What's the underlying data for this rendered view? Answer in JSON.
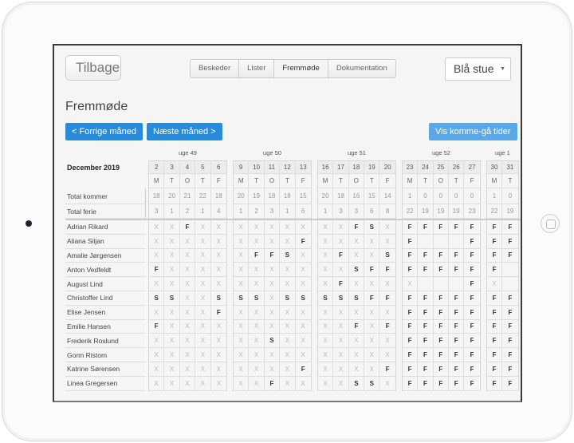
{
  "nav": {
    "back_label": "Tilbage",
    "tabs": [
      {
        "label": "Beskeder"
      },
      {
        "label": "Lister"
      },
      {
        "label": "Fremmøde",
        "active": true
      },
      {
        "label": "Dokumentation"
      }
    ],
    "room_select": "Blå stue"
  },
  "page": {
    "title": "Fremmøde",
    "prev_label": "<  Forrige måned",
    "next_label": "Næste måned  >",
    "show_times_label": "Vis komme-gå tider",
    "accent": "#2a8bd8"
  },
  "table": {
    "month": "December 2019",
    "total_kommer_label": "Total kommer",
    "total_ferie_label": "Total ferie",
    "weeks": [
      {
        "label": "uge 49",
        "days": [
          {
            "date": "2",
            "day": "M",
            "kommer": "18",
            "ferie": "3"
          },
          {
            "date": "3",
            "day": "T",
            "kommer": "20",
            "ferie": "1"
          },
          {
            "date": "4",
            "day": "O",
            "kommer": "21",
            "ferie": "2"
          },
          {
            "date": "5",
            "day": "T",
            "kommer": "22",
            "ferie": "1"
          },
          {
            "date": "6",
            "day": "F",
            "kommer": "18",
            "ferie": "4"
          }
        ]
      },
      {
        "label": "uge 50",
        "days": [
          {
            "date": "9",
            "day": "M",
            "kommer": "20",
            "ferie": "1"
          },
          {
            "date": "10",
            "day": "T",
            "kommer": "19",
            "ferie": "2"
          },
          {
            "date": "11",
            "day": "O",
            "kommer": "18",
            "ferie": "3"
          },
          {
            "date": "12",
            "day": "T",
            "kommer": "18",
            "ferie": "1"
          },
          {
            "date": "13",
            "day": "F",
            "kommer": "15",
            "ferie": "6"
          }
        ]
      },
      {
        "label": "uge 51",
        "days": [
          {
            "date": "16",
            "day": "M",
            "kommer": "20",
            "ferie": "1"
          },
          {
            "date": "17",
            "day": "T",
            "kommer": "18",
            "ferie": "3"
          },
          {
            "date": "18",
            "day": "O",
            "kommer": "16",
            "ferie": "3"
          },
          {
            "date": "19",
            "day": "T",
            "kommer": "15",
            "ferie": "6"
          },
          {
            "date": "20",
            "day": "F",
            "kommer": "14",
            "ferie": "8"
          }
        ]
      },
      {
        "label": "uge 52",
        "days": [
          {
            "date": "23",
            "day": "M",
            "kommer": "1",
            "ferie": "22"
          },
          {
            "date": "24",
            "day": "T",
            "kommer": "0",
            "ferie": "19"
          },
          {
            "date": "25",
            "day": "O",
            "kommer": "0",
            "ferie": "19"
          },
          {
            "date": "26",
            "day": "T",
            "kommer": "0",
            "ferie": "19"
          },
          {
            "date": "27",
            "day": "F",
            "kommer": "0",
            "ferie": "23"
          }
        ]
      },
      {
        "label": "uge 1",
        "days": [
          {
            "date": "30",
            "day": "M",
            "kommer": "1",
            "ferie": "22"
          },
          {
            "date": "31",
            "day": "T",
            "kommer": "0",
            "ferie": "19"
          }
        ]
      }
    ],
    "children": [
      {
        "name": "Adrian Rikard",
        "cells": [
          [
            "X",
            "X",
            "F",
            "X",
            "X"
          ],
          [
            "X",
            "X",
            "X",
            "X",
            "X"
          ],
          [
            "X",
            "X",
            "F",
            "S",
            "X"
          ],
          [
            "F",
            "F",
            "F",
            "F",
            "F"
          ],
          [
            "F",
            "F"
          ]
        ]
      },
      {
        "name": "Aliana Siljan",
        "cells": [
          [
            "X",
            "X",
            "X",
            "X",
            "X"
          ],
          [
            "X",
            "X",
            "X",
            "X",
            "F"
          ],
          [
            "X",
            "X",
            "X",
            "X",
            "X"
          ],
          [
            "F",
            "",
            "",
            "",
            "F"
          ],
          [
            "F",
            "F"
          ]
        ]
      },
      {
        "name": "Amalie Jørgensen",
        "cells": [
          [
            "X",
            "X",
            "X",
            "X",
            "X"
          ],
          [
            "X",
            "F",
            "F",
            "S",
            "X"
          ],
          [
            "X",
            "F",
            "X",
            "X",
            "S"
          ],
          [
            "F",
            "F",
            "F",
            "F",
            "F"
          ],
          [
            "F",
            "F"
          ]
        ]
      },
      {
        "name": "Anton Vedfeldt",
        "cells": [
          [
            "F",
            "X",
            "X",
            "X",
            "X"
          ],
          [
            "X",
            "X",
            "X",
            "X",
            "X"
          ],
          [
            "X",
            "X",
            "S",
            "F",
            "F"
          ],
          [
            "F",
            "F",
            "F",
            "F",
            "F"
          ],
          [
            "F",
            ""
          ]
        ]
      },
      {
        "name": "August Lind",
        "cells": [
          [
            "X",
            "X",
            "X",
            "X",
            "X"
          ],
          [
            "X",
            "X",
            "X",
            "X",
            "X"
          ],
          [
            "X",
            "F",
            "X",
            "X",
            "X"
          ],
          [
            "X",
            "",
            "",
            "",
            "F"
          ],
          [
            "X",
            ""
          ]
        ]
      },
      {
        "name": "Christoffer Lind",
        "cells": [
          [
            "S",
            "S",
            "X",
            "X",
            "S"
          ],
          [
            "S",
            "S",
            "X",
            "S",
            "S"
          ],
          [
            "S",
            "S",
            "S",
            "F",
            "F"
          ],
          [
            "F",
            "F",
            "F",
            "F",
            "F"
          ],
          [
            "F",
            "F"
          ]
        ]
      },
      {
        "name": "Elise Jensen",
        "cells": [
          [
            "X",
            "X",
            "X",
            "X",
            "F"
          ],
          [
            "X",
            "X",
            "X",
            "X",
            "X"
          ],
          [
            "X",
            "X",
            "X",
            "X",
            "X"
          ],
          [
            "F",
            "F",
            "F",
            "F",
            "F"
          ],
          [
            "F",
            "F"
          ]
        ]
      },
      {
        "name": "Emilie Hansen",
        "cells": [
          [
            "F",
            "X",
            "X",
            "X",
            "X"
          ],
          [
            "X",
            "X",
            "X",
            "X",
            "X"
          ],
          [
            "X",
            "X",
            "F",
            "X",
            "F"
          ],
          [
            "F",
            "F",
            "F",
            "F",
            "F"
          ],
          [
            "F",
            "F"
          ]
        ]
      },
      {
        "name": "Frederik Roslund",
        "cells": [
          [
            "X",
            "X",
            "X",
            "X",
            "X"
          ],
          [
            "X",
            "X",
            "S",
            "X",
            "X"
          ],
          [
            "X",
            "X",
            "X",
            "X",
            "X"
          ],
          [
            "F",
            "F",
            "F",
            "F",
            "F"
          ],
          [
            "F",
            "F"
          ]
        ]
      },
      {
        "name": "Gorm Ristom",
        "cells": [
          [
            "X",
            "X",
            "X",
            "X",
            "X"
          ],
          [
            "X",
            "X",
            "X",
            "X",
            "X"
          ],
          [
            "X",
            "X",
            "X",
            "X",
            "X"
          ],
          [
            "F",
            "F",
            "F",
            "F",
            "F"
          ],
          [
            "F",
            "F"
          ]
        ]
      },
      {
        "name": "Katrine Sørensen",
        "cells": [
          [
            "X",
            "X",
            "X",
            "X",
            "X"
          ],
          [
            "X",
            "X",
            "X",
            "X",
            "F"
          ],
          [
            "X",
            "X",
            "X",
            "X",
            "F"
          ],
          [
            "F",
            "F",
            "F",
            "F",
            "F"
          ],
          [
            "F",
            "F"
          ]
        ]
      },
      {
        "name": "Linea Gregersen",
        "cells": [
          [
            "X",
            "X",
            "X",
            "X",
            "X"
          ],
          [
            "X",
            "X",
            "F",
            "X",
            "X"
          ],
          [
            "X",
            "X",
            "S",
            "S",
            "X"
          ],
          [
            "F",
            "F",
            "F",
            "F",
            "F"
          ],
          [
            "F",
            "F"
          ]
        ]
      }
    ]
  }
}
